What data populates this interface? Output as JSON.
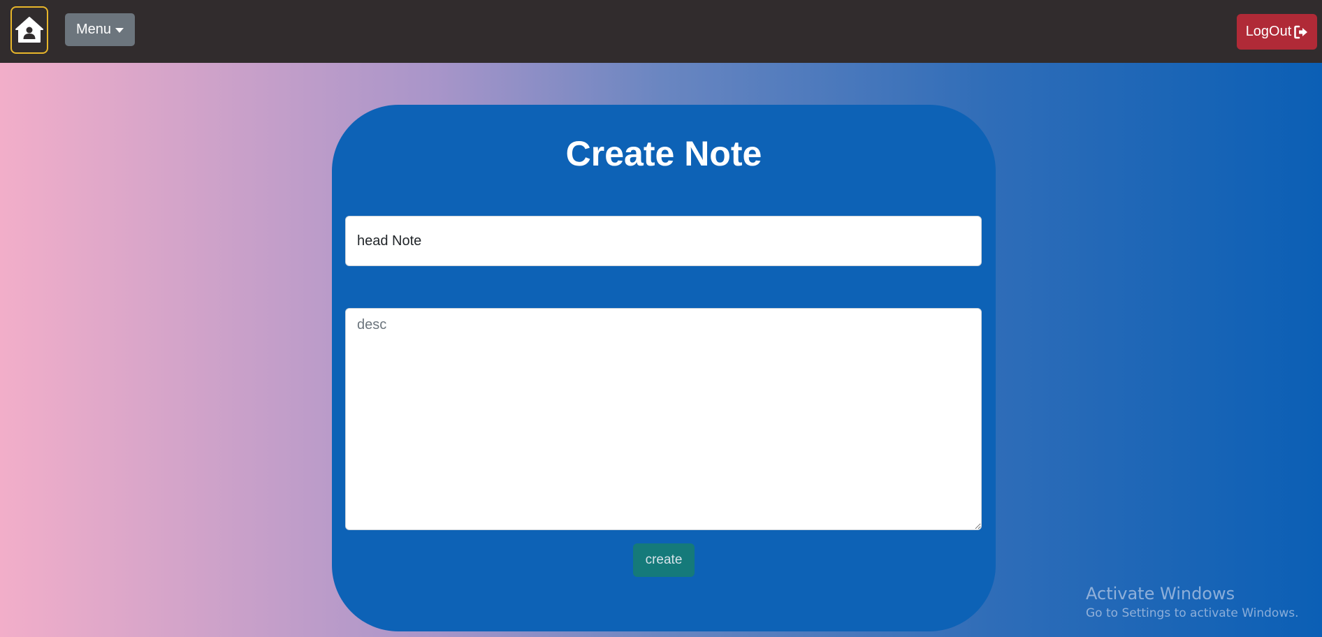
{
  "navbar": {
    "menu_label": "Menu",
    "logout_label": "LogOut"
  },
  "form": {
    "title": "Create Note",
    "title_value": "head Note",
    "desc_placeholder": "desc",
    "create_label": "create"
  },
  "watermark": {
    "title": "Activate Windows",
    "subtitle": "Go to Settings to activate Windows."
  },
  "icons": {
    "home": "house-user-icon",
    "menu_caret": "caret-down-icon",
    "logout": "sign-out-icon"
  },
  "colors": {
    "navbar": "#312c2d",
    "card": "#0d62b6",
    "home_border": "#e8b62a",
    "menu_button": "#6c757d",
    "logout_button": "#b02a37",
    "create_button": "#157a7a"
  }
}
